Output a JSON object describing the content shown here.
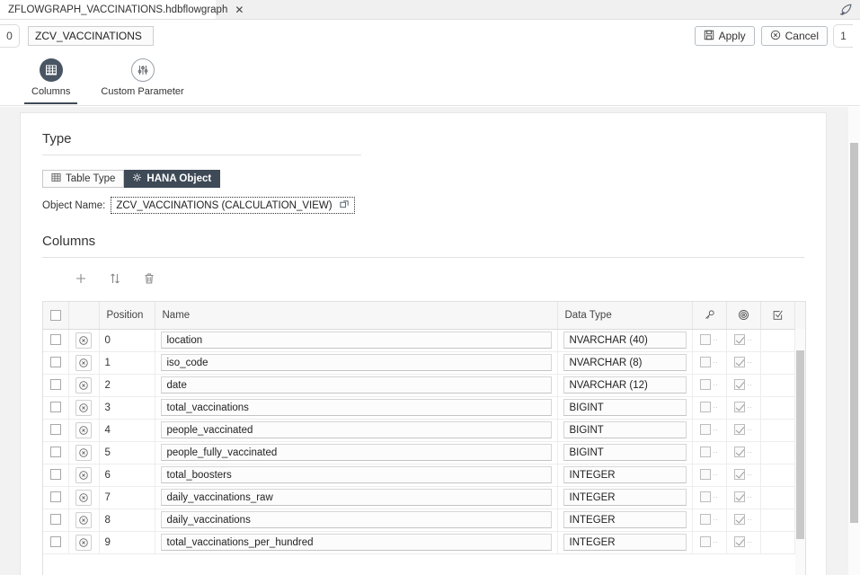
{
  "editor_tab": {
    "label": "ZFLOWGRAPH_VACCINATIONS.hdbflowgraph",
    "close": "✕"
  },
  "actionbar": {
    "left_badge": "0",
    "right_badge": "1",
    "node_name": "ZCV_VACCINATIONS",
    "apply_label": "Apply",
    "cancel_label": "Cancel",
    "apply_icon": "save-icon",
    "cancel_icon": "circle-x-icon",
    "deploy_icon": "rocket-icon"
  },
  "icon_tabs": [
    {
      "label": "Columns",
      "icon": "grid-icon",
      "active": true
    },
    {
      "label": "Custom Parameter",
      "icon": "sliders-icon",
      "active": false
    }
  ],
  "type_section": {
    "title": "Type",
    "segments": [
      {
        "label": "Table Type",
        "icon": "table-icon",
        "active": false
      },
      {
        "label": "HANA Object",
        "icon": "gear-icon",
        "active": true
      }
    ],
    "object_name_label": "Object Name:",
    "object_name_value": "ZCV_VACCINATIONS (CALCULATION_VIEW)",
    "object_open_icon": "open-external-icon"
  },
  "columns_section": {
    "title": "Columns",
    "toolbar": [
      {
        "name": "add-column-button",
        "icon": "plus-icon"
      },
      {
        "name": "sort-columns-button",
        "icon": "sort-arrows-icon"
      },
      {
        "name": "delete-column-button",
        "icon": "trash-icon"
      }
    ],
    "headers": {
      "select_all": "select-all-checkbox",
      "remove": "",
      "position": "Position",
      "name": "Name",
      "data_type": "Data Type",
      "key_icon": "key-icon",
      "target_icon": "target-icon",
      "check_icon": "checkbox-check-icon"
    },
    "rows": [
      {
        "position": "0",
        "name": "location",
        "data_type": "NVARCHAR (40)",
        "selected": false,
        "key": false,
        "target": true
      },
      {
        "position": "1",
        "name": "iso_code",
        "data_type": "NVARCHAR (8)",
        "selected": false,
        "key": false,
        "target": true
      },
      {
        "position": "2",
        "name": "date",
        "data_type": "NVARCHAR (12)",
        "selected": false,
        "key": false,
        "target": true
      },
      {
        "position": "3",
        "name": "total_vaccinations",
        "data_type": "BIGINT",
        "selected": false,
        "key": false,
        "target": true
      },
      {
        "position": "4",
        "name": "people_vaccinated",
        "data_type": "BIGINT",
        "selected": false,
        "key": false,
        "target": true
      },
      {
        "position": "5",
        "name": "people_fully_vaccinated",
        "data_type": "BIGINT",
        "selected": false,
        "key": false,
        "target": true
      },
      {
        "position": "6",
        "name": "total_boosters",
        "data_type": "INTEGER",
        "selected": false,
        "key": false,
        "target": true
      },
      {
        "position": "7",
        "name": "daily_vaccinations_raw",
        "data_type": "INTEGER",
        "selected": false,
        "key": false,
        "target": true
      },
      {
        "position": "8",
        "name": "daily_vaccinations",
        "data_type": "INTEGER",
        "selected": false,
        "key": false,
        "target": true
      },
      {
        "position": "9",
        "name": "total_vaccinations_per_hundred",
        "data_type": "INTEGER",
        "selected": false,
        "key": false,
        "target": true
      }
    ]
  }
}
